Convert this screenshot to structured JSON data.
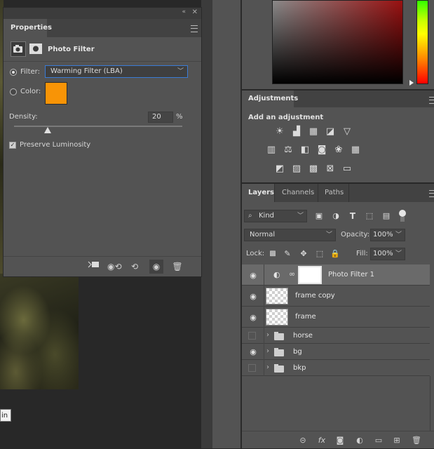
{
  "canvas": {
    "tooltip_text": "in"
  },
  "properties": {
    "tab_label": "Properties",
    "title": "Photo Filter",
    "filter_label": "Filter:",
    "filter_value": "Warming Filter (LBA)",
    "color_label": "Color:",
    "color_value": "#f89406",
    "density_label": "Density:",
    "density_value": "20",
    "density_unit": "%",
    "density_fraction": 0.2,
    "preserve_label": "Preserve Luminosity",
    "preserve_checked": true
  },
  "adjustments": {
    "tab_label": "Adjustments",
    "subtitle": "Add an adjustment"
  },
  "layers": {
    "tabs": [
      "Layers",
      "Channels",
      "Paths"
    ],
    "kind_label": "Kind",
    "blend_mode": "Normal",
    "opacity_label": "Opacity:",
    "opacity_value": "100%",
    "lock_label": "Lock:",
    "fill_label": "Fill:",
    "fill_value": "100%",
    "items": [
      {
        "name": "Photo Filter 1",
        "visible": true,
        "type": "adjustment",
        "selected": true
      },
      {
        "name": "frame copy",
        "visible": true,
        "type": "pixel"
      },
      {
        "name": "frame",
        "visible": true,
        "type": "pixel"
      },
      {
        "name": "horse",
        "visible": false,
        "type": "group"
      },
      {
        "name": "bg",
        "visible": true,
        "type": "group"
      },
      {
        "name": "bkp",
        "visible": false,
        "type": "group"
      }
    ]
  },
  "colors": {
    "accent": "#3a7bd5",
    "panel": "#535353",
    "filter_swatch": "#f89406"
  }
}
